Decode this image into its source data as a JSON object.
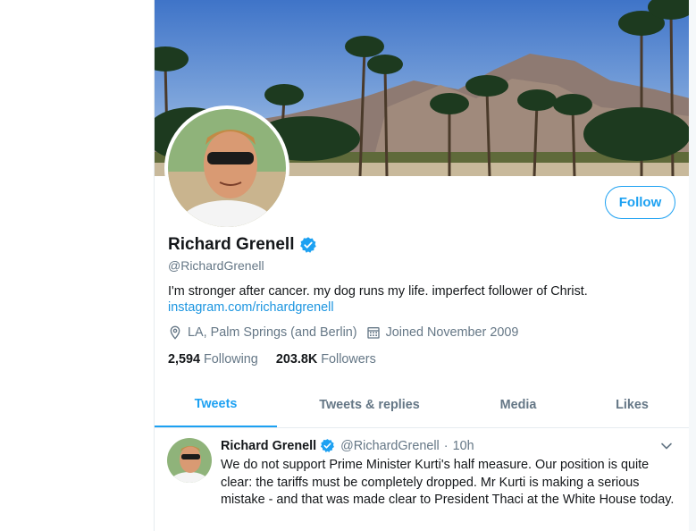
{
  "profile": {
    "display_name": "Richard Grenell",
    "handle": "@RichardGrenell",
    "bio": "I'm stronger after cancer. my dog runs my life. imperfect follower of Christ.",
    "link": "instagram.com/richardgrenell",
    "location": "LA, Palm Springs (and Berlin)",
    "joined": "Joined November 2009",
    "location_icon": "location-pin-icon",
    "joined_icon": "calendar-icon",
    "verified_icon": "verified-badge-icon"
  },
  "actions": {
    "follow_label": "Follow"
  },
  "stats": {
    "following_count": "2,594",
    "following_label": "Following",
    "followers_count": "203.8K",
    "followers_label": "Followers"
  },
  "tabs": [
    {
      "label": "Tweets",
      "active": true
    },
    {
      "label": "Tweets & replies",
      "active": false
    },
    {
      "label": "Media",
      "active": false
    },
    {
      "label": "Likes",
      "active": false
    }
  ],
  "tweet": {
    "name": "Richard Grenell",
    "handle": "@RichardGrenell",
    "separator": "·",
    "time": "10h",
    "text": "We do not support Prime Minister Kurti's half measure. Our position is quite clear: the tariffs must be completely dropped. Mr Kurti is making a serious mistake - and that was made clear to President Thaci at the White House today."
  },
  "colors": {
    "accent": "#1da1f2",
    "link": "#1b95e0",
    "secondary_text": "#657786",
    "border": "#e6ecf0"
  }
}
